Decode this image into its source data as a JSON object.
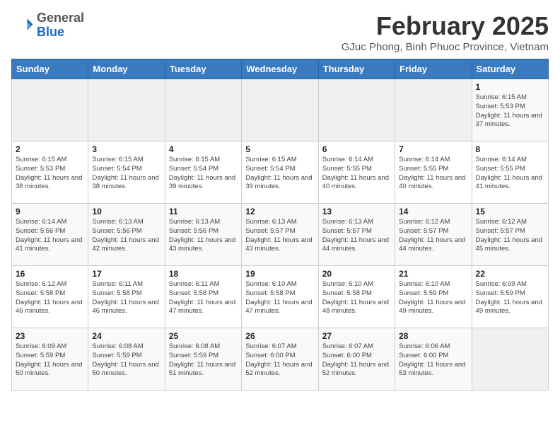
{
  "header": {
    "logo_general": "General",
    "logo_blue": "Blue",
    "month_year": "February 2025",
    "location": "GJuc Phong, Binh Phuoc Province, Vietnam"
  },
  "weekdays": [
    "Sunday",
    "Monday",
    "Tuesday",
    "Wednesday",
    "Thursday",
    "Friday",
    "Saturday"
  ],
  "weeks": [
    [
      {
        "day": "",
        "info": ""
      },
      {
        "day": "",
        "info": ""
      },
      {
        "day": "",
        "info": ""
      },
      {
        "day": "",
        "info": ""
      },
      {
        "day": "",
        "info": ""
      },
      {
        "day": "",
        "info": ""
      },
      {
        "day": "1",
        "info": "Sunrise: 6:15 AM\nSunset: 5:53 PM\nDaylight: 11 hours\nand 37 minutes."
      }
    ],
    [
      {
        "day": "2",
        "info": "Sunrise: 6:15 AM\nSunset: 5:53 PM\nDaylight: 11 hours\nand 38 minutes."
      },
      {
        "day": "3",
        "info": "Sunrise: 6:15 AM\nSunset: 5:54 PM\nDaylight: 11 hours\nand 38 minutes."
      },
      {
        "day": "4",
        "info": "Sunrise: 6:15 AM\nSunset: 5:54 PM\nDaylight: 11 hours\nand 39 minutes."
      },
      {
        "day": "5",
        "info": "Sunrise: 6:15 AM\nSunset: 5:54 PM\nDaylight: 11 hours\nand 39 minutes."
      },
      {
        "day": "6",
        "info": "Sunrise: 6:14 AM\nSunset: 5:55 PM\nDaylight: 11 hours\nand 40 minutes."
      },
      {
        "day": "7",
        "info": "Sunrise: 6:14 AM\nSunset: 5:55 PM\nDaylight: 11 hours\nand 40 minutes."
      },
      {
        "day": "8",
        "info": "Sunrise: 6:14 AM\nSunset: 5:55 PM\nDaylight: 11 hours\nand 41 minutes."
      }
    ],
    [
      {
        "day": "9",
        "info": "Sunrise: 6:14 AM\nSunset: 5:56 PM\nDaylight: 11 hours\nand 41 minutes."
      },
      {
        "day": "10",
        "info": "Sunrise: 6:13 AM\nSunset: 5:56 PM\nDaylight: 11 hours\nand 42 minutes."
      },
      {
        "day": "11",
        "info": "Sunrise: 6:13 AM\nSunset: 5:56 PM\nDaylight: 11 hours\nand 43 minutes."
      },
      {
        "day": "12",
        "info": "Sunrise: 6:13 AM\nSunset: 5:57 PM\nDaylight: 11 hours\nand 43 minutes."
      },
      {
        "day": "13",
        "info": "Sunrise: 6:13 AM\nSunset: 5:57 PM\nDaylight: 11 hours\nand 44 minutes."
      },
      {
        "day": "14",
        "info": "Sunrise: 6:12 AM\nSunset: 5:57 PM\nDaylight: 11 hours\nand 44 minutes."
      },
      {
        "day": "15",
        "info": "Sunrise: 6:12 AM\nSunset: 5:57 PM\nDaylight: 11 hours\nand 45 minutes."
      }
    ],
    [
      {
        "day": "16",
        "info": "Sunrise: 6:12 AM\nSunset: 5:58 PM\nDaylight: 11 hours\nand 46 minutes."
      },
      {
        "day": "17",
        "info": "Sunrise: 6:11 AM\nSunset: 5:58 PM\nDaylight: 11 hours\nand 46 minutes."
      },
      {
        "day": "18",
        "info": "Sunrise: 6:11 AM\nSunset: 5:58 PM\nDaylight: 11 hours\nand 47 minutes."
      },
      {
        "day": "19",
        "info": "Sunrise: 6:10 AM\nSunset: 5:58 PM\nDaylight: 11 hours\nand 47 minutes."
      },
      {
        "day": "20",
        "info": "Sunrise: 6:10 AM\nSunset: 5:58 PM\nDaylight: 11 hours\nand 48 minutes."
      },
      {
        "day": "21",
        "info": "Sunrise: 6:10 AM\nSunset: 5:59 PM\nDaylight: 11 hours\nand 49 minutes."
      },
      {
        "day": "22",
        "info": "Sunrise: 6:09 AM\nSunset: 5:59 PM\nDaylight: 11 hours\nand 49 minutes."
      }
    ],
    [
      {
        "day": "23",
        "info": "Sunrise: 6:09 AM\nSunset: 5:59 PM\nDaylight: 11 hours\nand 50 minutes."
      },
      {
        "day": "24",
        "info": "Sunrise: 6:08 AM\nSunset: 5:59 PM\nDaylight: 11 hours\nand 50 minutes."
      },
      {
        "day": "25",
        "info": "Sunrise: 6:08 AM\nSunset: 5:59 PM\nDaylight: 11 hours\nand 51 minutes."
      },
      {
        "day": "26",
        "info": "Sunrise: 6:07 AM\nSunset: 6:00 PM\nDaylight: 11 hours\nand 52 minutes."
      },
      {
        "day": "27",
        "info": "Sunrise: 6:07 AM\nSunset: 6:00 PM\nDaylight: 11 hours\nand 52 minutes."
      },
      {
        "day": "28",
        "info": "Sunrise: 6:06 AM\nSunset: 6:00 PM\nDaylight: 11 hours\nand 53 minutes."
      },
      {
        "day": "",
        "info": ""
      }
    ]
  ]
}
